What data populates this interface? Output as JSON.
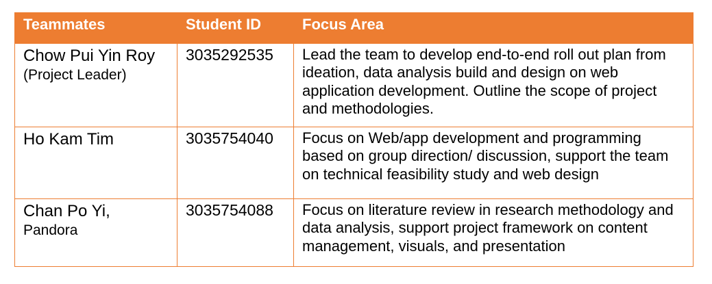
{
  "table": {
    "headers": [
      "Teammates",
      "Student ID",
      "Focus Area"
    ],
    "rows": [
      {
        "name": "Chow Pui Yin Roy",
        "name_note": "(Project Leader)",
        "student_id": "3035292535",
        "focus": "Lead the team to develop end-to-end roll out plan from ideation, data analysis build and design on web application development. Outline the scope of project and methodologies."
      },
      {
        "name": "Ho Kam Tim",
        "name_note": "",
        "student_id": "3035754040",
        "focus": "Focus on Web/app development and programming based on group direction/ discussion, support the team on technical feasibility study and web design"
      },
      {
        "name": "Chan Po Yi,",
        "name_note": "Pandora",
        "student_id": "3035754088",
        "focus": "Focus on literature review in research methodology and data analysis, support project framework on content management, visuals, and presentation"
      }
    ]
  },
  "colors": {
    "header_background": "#ED7D31",
    "header_text": "#FFFFFF",
    "border": "#ED7D31"
  }
}
